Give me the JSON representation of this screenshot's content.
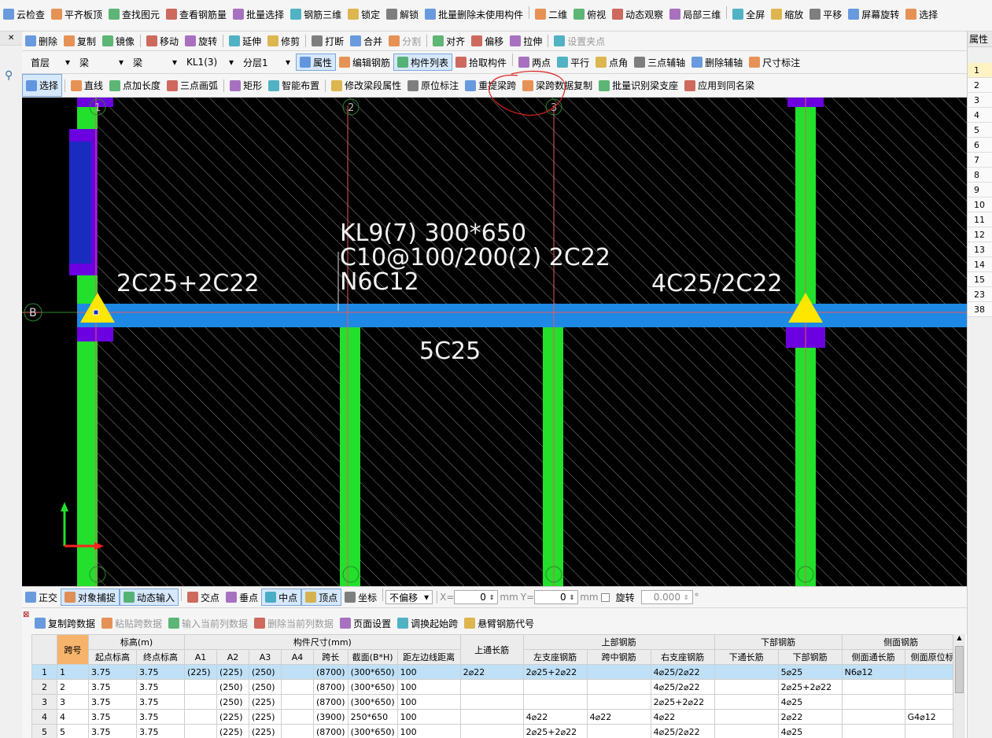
{
  "menubar": {
    "items": [
      "云检查",
      "平齐板顶",
      "查找图元",
      "查看钢筋量",
      "批量选择",
      "钢筋三维",
      "锁定",
      "解锁",
      "批量删除未使用构件",
      "二维",
      "俯视",
      "动态观察",
      "局部三维",
      "全屏",
      "缩放",
      "平移",
      "屏幕旋转",
      "选择"
    ]
  },
  "toolbar2": {
    "items": [
      "删除",
      "复制",
      "镜像",
      "移动",
      "旋转",
      "延伸",
      "修剪",
      "打断",
      "合并",
      "分割",
      "对齐",
      "偏移",
      "拉伸",
      "设置夹点"
    ]
  },
  "toolbar3": {
    "floor": "首层",
    "category": "梁",
    "subcategory": "梁",
    "component": "KL1(3)",
    "layer": "分层1",
    "buttons": [
      "属性",
      "编辑钢筋",
      "构件列表",
      "拾取构件",
      "两点",
      "平行",
      "点角",
      "三点辅轴",
      "删除辅轴",
      "尺寸标注"
    ]
  },
  "toolbar4": {
    "items": [
      "选择",
      "直线",
      "点加长度",
      "三点画弧",
      "矩形",
      "智能布置",
      "修改梁段属性",
      "原位标注",
      "重提梁跨",
      "梁跨数据复制",
      "批量识别梁支座",
      "应用到同名梁"
    ]
  },
  "canvas": {
    "grid_labels": [
      "1",
      "2",
      "3",
      "B"
    ],
    "beam_label": [
      "KL9(7) 300*650",
      "C10@100/200(2) 2C22",
      "N6C12"
    ],
    "left_support": "2C25+2C22",
    "right_support": "4C25/2C22",
    "bottom": "5C25"
  },
  "statusbar": {
    "items": [
      "正交",
      "对象捕捉",
      "动态输入",
      "交点",
      "垂点",
      "中点",
      "顶点",
      "坐标"
    ],
    "offset_mode": "不偏移",
    "x_label": "X=",
    "x_value": "0",
    "y_label": "Y=",
    "y_value": "0",
    "unit": "mm",
    "rotate_label": "旋转",
    "rotate_value": "0.000",
    "degree": "°"
  },
  "table_toolbar": {
    "items": [
      "复制跨数据",
      "粘贴跨数据",
      "输入当前列数据",
      "删除当前列数据",
      "页面设置",
      "调换起始跨",
      "悬臂钢筋代号"
    ]
  },
  "table": {
    "group_headers": [
      "跨号",
      "标高(m)",
      "构件尺寸(mm)",
      "上通长筋",
      "上部钢筋",
      "下部钢筋",
      "侧面钢筋"
    ],
    "headers": [
      "起点标高",
      "终点标高",
      "A1",
      "A2",
      "A3",
      "A4",
      "跨长",
      "截面(B*H)",
      "距左边线距离",
      "左支座钢筋",
      "跨中钢筋",
      "右支座钢筋",
      "下通长筋",
      "下部钢筋",
      "侧面通长筋",
      "侧面原位标"
    ],
    "rows": [
      [
        "1",
        "1",
        "3.75",
        "3.75",
        "(225)",
        "(225)",
        "(250)",
        "",
        "(8700)",
        "(300*650)",
        "100",
        "2⌀22",
        "2⌀25+2⌀22",
        "",
        "4⌀25/2⌀22",
        "",
        "5⌀25",
        "N6⌀12",
        ""
      ],
      [
        "2",
        "2",
        "3.75",
        "3.75",
        "",
        "(250)",
        "(250)",
        "",
        "(8700)",
        "(300*650)",
        "100",
        "",
        "",
        "",
        "4⌀25/2⌀22",
        "",
        "2⌀25+2⌀22",
        "",
        ""
      ],
      [
        "3",
        "3",
        "3.75",
        "3.75",
        "",
        "(250)",
        "(225)",
        "",
        "(8700)",
        "(300*650)",
        "100",
        "",
        "",
        "",
        "2⌀25+2⌀22",
        "",
        "4⌀25",
        "",
        ""
      ],
      [
        "4",
        "4",
        "3.75",
        "3.75",
        "",
        "(225)",
        "(225)",
        "",
        "(3900)",
        "250*650",
        "100",
        "",
        "4⌀22",
        "4⌀22",
        "4⌀22",
        "",
        "2⌀22",
        "",
        "G4⌀12"
      ],
      [
        "5",
        "5",
        "3.75",
        "3.75",
        "",
        "(225)",
        "(225)",
        "",
        "(8700)",
        "(300*650)",
        "100",
        "",
        "2⌀25+2⌀22",
        "",
        "4⌀25/2⌀22",
        "",
        "4⌀25",
        "",
        ""
      ]
    ]
  },
  "rightpanel": {
    "title": "属性",
    "rows": [
      "1",
      "2",
      "3",
      "4",
      "5",
      "6",
      "7",
      "8",
      "9",
      "10",
      "11",
      "12",
      "13",
      "14",
      "15",
      "23",
      "38"
    ]
  }
}
